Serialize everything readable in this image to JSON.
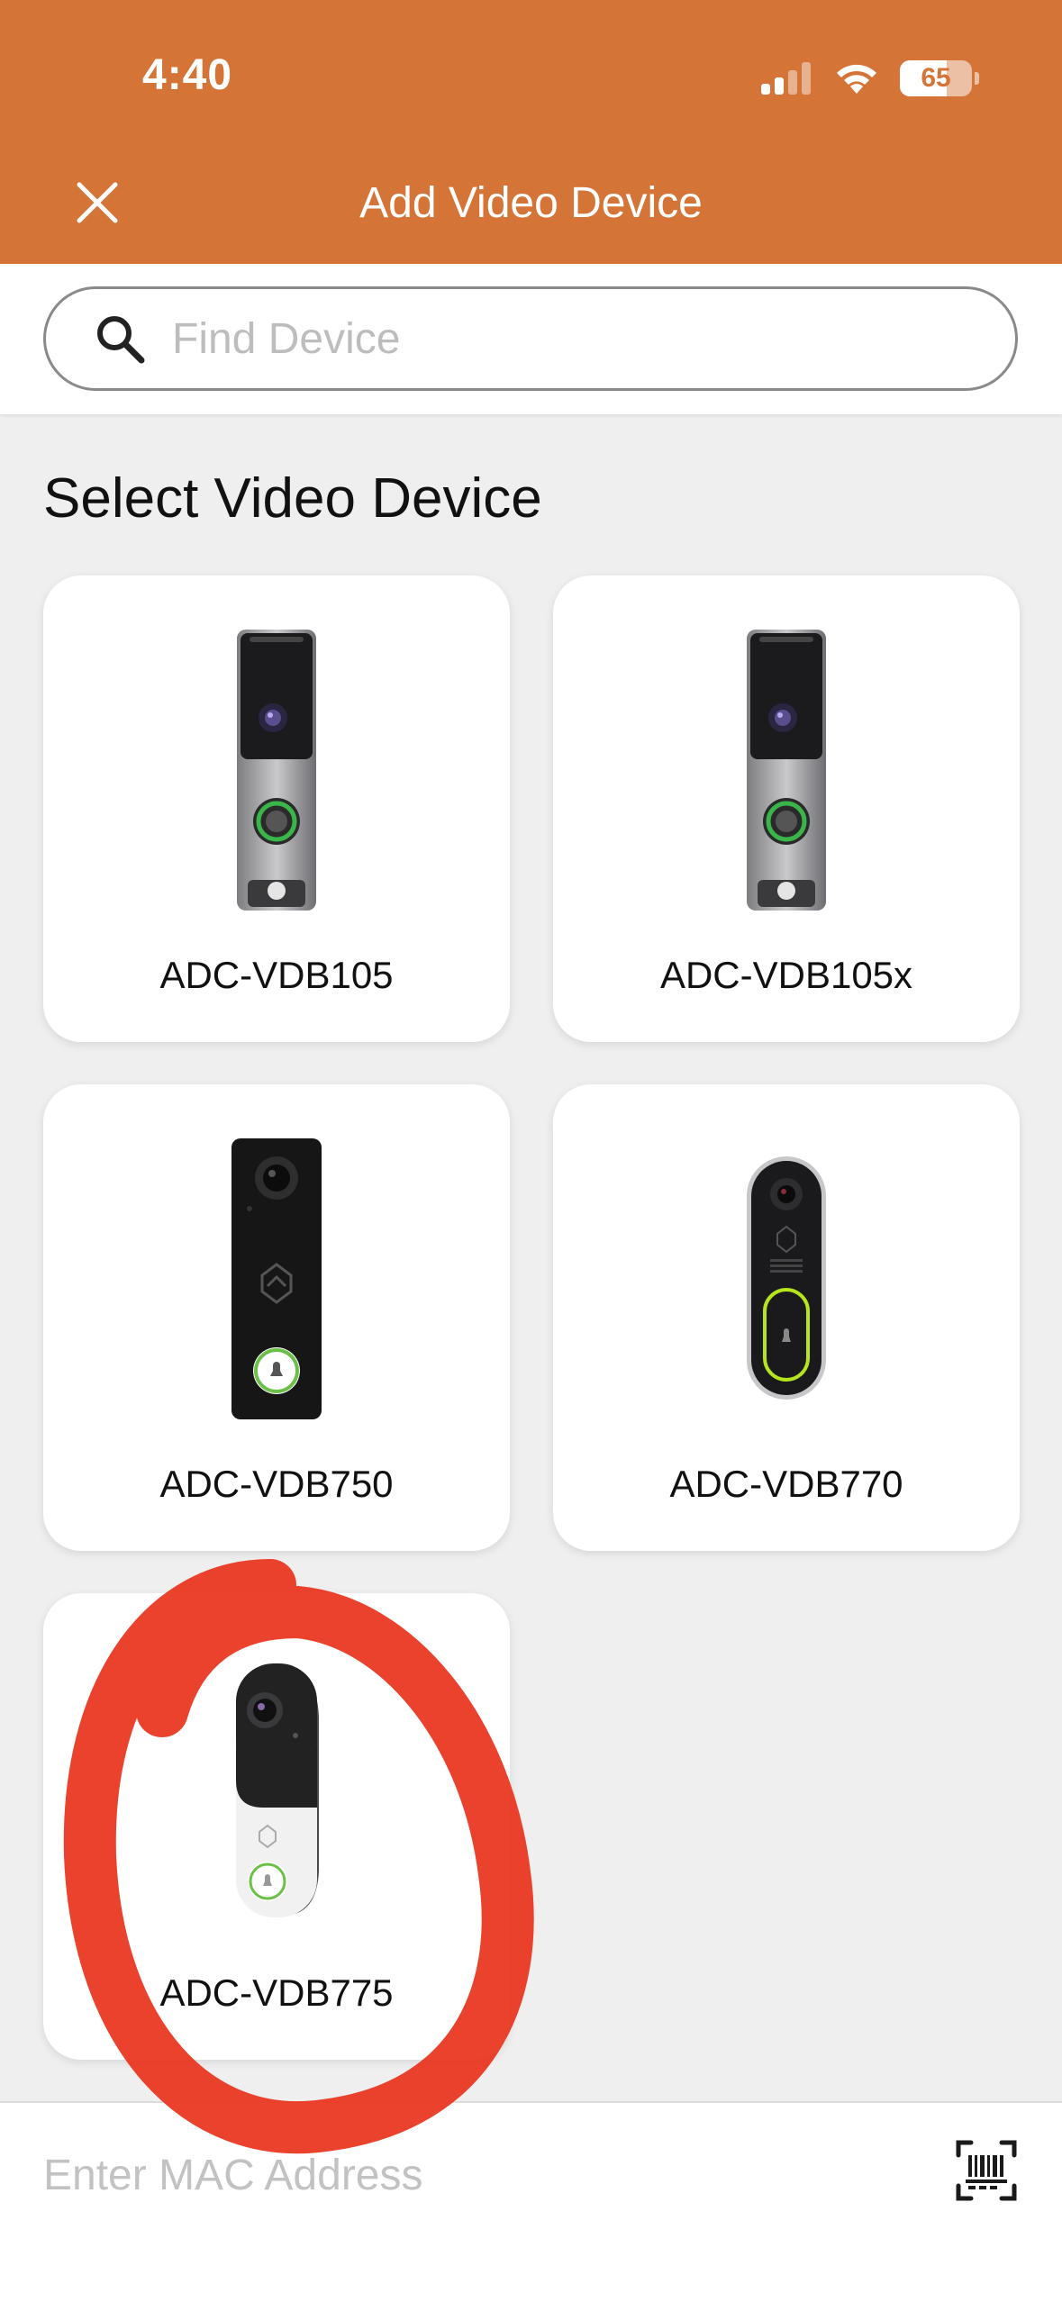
{
  "status_bar": {
    "time": "4:40",
    "battery": "65",
    "signal_icon": "cellular-signal-icon",
    "wifi_icon": "wifi-icon"
  },
  "header": {
    "title": "Add Video Device",
    "close_icon": "close-icon",
    "background_color": "#d57437"
  },
  "search": {
    "placeholder": "Find Device",
    "icon": "search-icon"
  },
  "section": {
    "title": "Select Video Device"
  },
  "devices": [
    {
      "label": "ADC-VDB105",
      "icon": "doorbell-vdb105-image"
    },
    {
      "label": "ADC-VDB105x",
      "icon": "doorbell-vdb105x-image"
    },
    {
      "label": "ADC-VDB750",
      "icon": "doorbell-vdb750-image"
    },
    {
      "label": "ADC-VDB770",
      "icon": "doorbell-vdb770-image"
    },
    {
      "label": "ADC-VDB775",
      "icon": "doorbell-vdb775-image"
    }
  ],
  "mac": {
    "placeholder": "Enter MAC Address",
    "scan_icon": "barcode-scan-icon"
  },
  "annotation_color": "#e8321b"
}
